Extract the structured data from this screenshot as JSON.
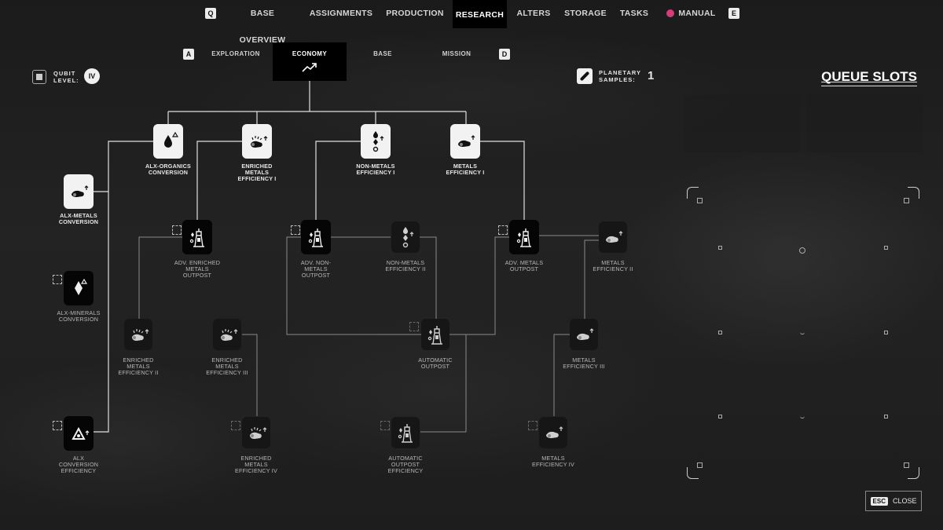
{
  "top_nav": {
    "left_key": "Q",
    "right_key": "E",
    "tabs": [
      "BASE OVERVIEW",
      "ASSIGNMENTS",
      "PRODUCTION",
      "RESEARCH",
      "ALTERS",
      "STORAGE",
      "TASKS"
    ],
    "active_tab": "RESEARCH",
    "manual_label": "MANUAL",
    "manual_dot_color": "#d63b7a"
  },
  "sub_nav": {
    "left_key": "A",
    "right_key": "D",
    "tabs": [
      "EXPLORATION",
      "ECONOMY",
      "BASE",
      "MISSION"
    ],
    "active_tab": "ECONOMY"
  },
  "qubit": {
    "label_line1": "QUBIT",
    "label_line2": "LEVEL:",
    "value": "IV"
  },
  "samples": {
    "label_line1": "PLANETARY",
    "label_line2": "SAMPLES:",
    "value": "1"
  },
  "queue": {
    "title": "QUEUE SLOTS"
  },
  "close": {
    "key": "ESC",
    "label": "CLOSE"
  },
  "nodes": [
    {
      "id": "alx-organics",
      "label": [
        "ALX-ORGANICS",
        "CONVERSION"
      ],
      "state": "researched",
      "icon": "drop-icon"
    },
    {
      "id": "enriched-1",
      "label": [
        "ENRICHED",
        "METALS",
        "EFFICIENCY I"
      ],
      "state": "researched",
      "icon": "enriched-metals-icon"
    },
    {
      "id": "nonmetals-1",
      "label": [
        "NON-METALS",
        "EFFICIENCY I"
      ],
      "state": "researched",
      "icon": "non-metals-icon"
    },
    {
      "id": "metals-1",
      "label": [
        "METALS",
        "EFFICIENCY I"
      ],
      "state": "researched",
      "icon": "metals-icon"
    },
    {
      "id": "alx-metals",
      "label": [
        "ALX-METALS",
        "CONVERSION"
      ],
      "state": "researched",
      "icon": "metals-icon"
    },
    {
      "id": "adv-enriched",
      "label": [
        "ADV. ENRICHED",
        "METALS",
        "OUTPOST"
      ],
      "state": "available",
      "icon": "outpost-icon"
    },
    {
      "id": "adv-nonmetals",
      "label": [
        "ADV. NON-",
        "METALS",
        "OUTPOST"
      ],
      "state": "available",
      "icon": "outpost-icon"
    },
    {
      "id": "nonmetals-2",
      "label": [
        "NON-METALS",
        "EFFICIENCY II"
      ],
      "state": "locked",
      "icon": "non-metals-icon"
    },
    {
      "id": "adv-metals",
      "label": [
        "ADV. METALS",
        "OUTPOST"
      ],
      "state": "available",
      "icon": "outpost-icon"
    },
    {
      "id": "metals-2",
      "label": [
        "METALS",
        "EFFICIENCY II"
      ],
      "state": "locked",
      "icon": "metals-icon"
    },
    {
      "id": "alx-minerals",
      "label": [
        "ALX-MINERALS",
        "CONVERSION"
      ],
      "state": "available",
      "icon": "mineral-icon"
    },
    {
      "id": "enriched-2",
      "label": [
        "ENRICHED",
        "METALS",
        "EFFICIENCY II"
      ],
      "state": "locked",
      "icon": "enriched-metals-icon"
    },
    {
      "id": "enriched-3",
      "label": [
        "ENRICHED",
        "METALS",
        "EFFICIENCY III"
      ],
      "state": "locked",
      "icon": "enriched-metals-icon"
    },
    {
      "id": "auto-outpost",
      "label": [
        "AUTOMATIC",
        "OUTPOST"
      ],
      "state": "locked",
      "icon": "outpost-icon"
    },
    {
      "id": "metals-3",
      "label": [
        "METALS",
        "EFFICIENCY III"
      ],
      "state": "locked",
      "icon": "metals-icon"
    },
    {
      "id": "alx-efficiency",
      "label": [
        "ALX",
        "CONVERSION",
        "EFFICIENCY"
      ],
      "state": "available",
      "icon": "alx-icon"
    },
    {
      "id": "enriched-4",
      "label": [
        "ENRICHED",
        "METALS",
        "EFFICIENCY IV"
      ],
      "state": "locked",
      "icon": "enriched-metals-icon"
    },
    {
      "id": "auto-outpost-eff",
      "label": [
        "AUTOMATIC",
        "OUTPOST",
        "EFFICIENCY"
      ],
      "state": "locked",
      "icon": "outpost-icon"
    },
    {
      "id": "metals-4",
      "label": [
        "METALS",
        "EFFICIENCY IV"
      ],
      "state": "locked",
      "icon": "metals-icon"
    }
  ]
}
